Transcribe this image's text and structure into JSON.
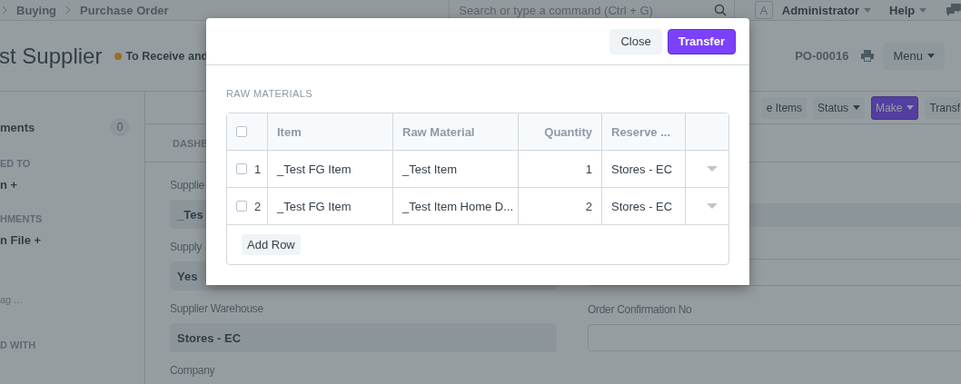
{
  "navbar": {
    "breadcrumbs": [
      "Buying",
      "Purchase Order"
    ],
    "search": {
      "placeholder": "Search or type a command (Ctrl + G)"
    },
    "avatar": "A",
    "user_menu": "Administrator",
    "help_menu": "Help"
  },
  "page_head": {
    "title": "st Supplier",
    "status": "To Receive and",
    "doc_name": "PO-00016",
    "menu_button": "Menu"
  },
  "sidebar": {
    "items": [
      {
        "kind": "count",
        "label": "ments",
        "count": "0"
      },
      {
        "kind": "heading",
        "label": "ED TO"
      },
      {
        "kind": "link",
        "label": "n +"
      },
      {
        "kind": "heading",
        "label": "HMENTS"
      },
      {
        "kind": "link",
        "label": "n File +"
      },
      {
        "kind": "muted",
        "label": "ag ..."
      },
      {
        "kind": "heading",
        "label": "D WITH"
      }
    ]
  },
  "toolbar": {
    "buttons": [
      {
        "label": "e Items",
        "kind": "plain"
      },
      {
        "label": "Status",
        "kind": "dropdown"
      },
      {
        "label": "Make",
        "kind": "primary-dropdown"
      },
      {
        "label": "Transf",
        "kind": "plain"
      }
    ]
  },
  "form": {
    "section": "DASHB",
    "left_fields": [
      {
        "label": "Supplie",
        "value": "_Tes"
      },
      {
        "label": "Supply",
        "value": "Yes"
      },
      {
        "label": "Supplier Warehouse",
        "value": "Stores - EC"
      },
      {
        "label": "Company"
      }
    ],
    "right_fields": [
      {
        "kind": "readonly"
      },
      {
        "kind": "input"
      },
      {
        "kind": "input",
        "label": "Order Confirmation No"
      }
    ]
  },
  "dialog": {
    "buttons": [
      {
        "label": "Close",
        "kind": "secondary"
      },
      {
        "label": "Transfer",
        "kind": "primary"
      }
    ],
    "section": "RAW MATERIALS",
    "table": {
      "columns": [
        "Item",
        "Raw Material",
        "Quantity",
        "Reserve ..."
      ],
      "header_checked": false,
      "rows": [
        {
          "checked": false,
          "index": "1",
          "item": "_Test FG Item",
          "raw_material": "_Test Item",
          "quantity": "1",
          "warehouse": "Stores - EC"
        },
        {
          "checked": false,
          "index": "2",
          "item": "_Test FG Item",
          "raw_material": "_Test Item Home D...",
          "quantity": "2",
          "warehouse": "Stores - EC"
        }
      ],
      "add_row": "Add Row"
    }
  }
}
